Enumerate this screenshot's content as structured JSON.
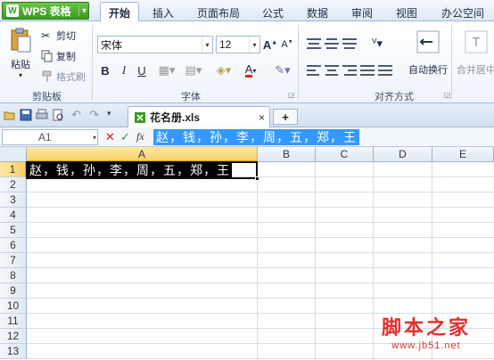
{
  "menu": {
    "app_button": "WPS 表格",
    "tabs": [
      "开始",
      "插入",
      "页面布局",
      "公式",
      "数据",
      "审阅",
      "视图",
      "办公空间"
    ]
  },
  "ribbon": {
    "clipboard": {
      "paste": "粘贴",
      "cut": "剪切",
      "copy": "复制",
      "format_painter": "格式刷",
      "label": "剪贴板"
    },
    "font": {
      "name": "宋体",
      "size": "12",
      "label": "字体"
    },
    "alignment": {
      "label": "对齐方式",
      "wrap": "自动换行",
      "merge": "合并居中"
    }
  },
  "document": {
    "tab_title": "花名册.xls",
    "close_glyph": "×",
    "add_glyph": "+"
  },
  "formula_bar": {
    "cell_ref": "A1",
    "cancel": "✕",
    "confirm": "✓",
    "fx": "fx",
    "value": "赵，钱，孙，李，周，五，郑，王"
  },
  "grid": {
    "columns": [
      "A",
      "B",
      "C",
      "D",
      "E"
    ],
    "rows": [
      "1",
      "2",
      "3",
      "4",
      "5",
      "6",
      "7",
      "8",
      "9",
      "10",
      "11",
      "12",
      "13"
    ],
    "a1_value": "赵，钱，孙，李，周，五，郑，王"
  },
  "watermark": {
    "cn": "脚本之家",
    "en": "www.jb51.net"
  },
  "colors": {
    "accent_green": "#3a9a1e",
    "selection_blue": "#3399ff",
    "header_highlight": "#f7cf66",
    "watermark_red": "#e3302b"
  }
}
